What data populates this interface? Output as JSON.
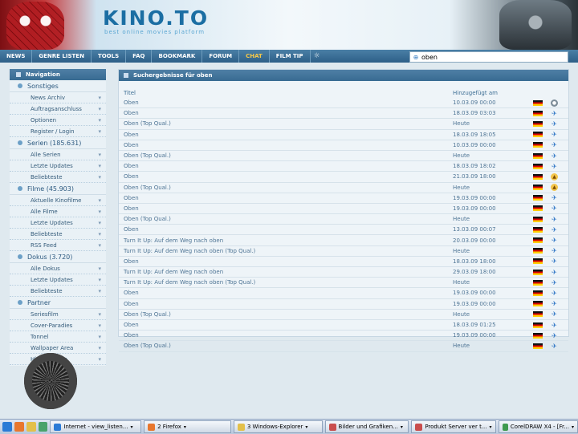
{
  "brand": {
    "logo": "KINO.TO",
    "tagline": "best online movies platform"
  },
  "nav": {
    "items": [
      "NEWS",
      "GENRE LISTEN",
      "TOOLS",
      "FAQ",
      "BOOKMARK",
      "FORUM",
      "CHAT",
      "FILM TIP"
    ],
    "active": "CHAT"
  },
  "search": {
    "value": "oben"
  },
  "sidebar": {
    "header": "Navigation",
    "sections": [
      {
        "title": "Sonstiges",
        "items": [
          "News Archiv",
          "Auftragsanschluss",
          "Optionen",
          "Register / Login"
        ]
      },
      {
        "title": "Serien (185.631)",
        "items": [
          "Alle Serien",
          "Letzte Updates",
          "Beliebteste"
        ]
      },
      {
        "title": "Filme (45.903)",
        "items": [
          "Aktuelle Kinofilme",
          "Alle Filme",
          "Letzte Updates",
          "Beliebteste",
          "RSS Feed"
        ]
      },
      {
        "title": "Dokus (3.720)",
        "items": [
          "Alle Dokus",
          "Letzte Updates",
          "Beliebteste"
        ]
      },
      {
        "title": "Partner",
        "items": [
          "Seriesfilm",
          "Cover-Paradies",
          "Tonnel",
          "Wallpaper Area",
          "Hir-Phys.com"
        ]
      }
    ]
  },
  "results": {
    "header": "Suchergebnisse für oben",
    "col_title": "Titel",
    "col_date": "Hinzugefügt am",
    "rows": [
      {
        "title": "Oben",
        "date": "10.03.09 00:00",
        "hoster": "grey"
      },
      {
        "title": "Oben",
        "date": "18.03.09 03:03",
        "hoster": "blue"
      },
      {
        "title": "Oben (Top Qual.)",
        "date": "Heute",
        "hoster": "blue"
      },
      {
        "title": "Oben",
        "date": "18.03.09 18:05",
        "hoster": "blue"
      },
      {
        "title": "Oben",
        "date": "10.03.09 00:00",
        "hoster": "blue"
      },
      {
        "title": "Oben (Top Qual.)",
        "date": "Heute",
        "hoster": "blue"
      },
      {
        "title": "Oben",
        "date": "18.03.09 18:02",
        "hoster": "blue"
      },
      {
        "title": "Oben",
        "date": "21.03.09 18:00",
        "hoster": "yellow"
      },
      {
        "title": "Oben (Top Qual.)",
        "date": "Heute",
        "hoster": "yellow"
      },
      {
        "title": "Oben",
        "date": "19.03.09 00:00",
        "hoster": "blue"
      },
      {
        "title": "Oben",
        "date": "19.03.09 00:00",
        "hoster": "blue"
      },
      {
        "title": "Oben (Top Qual.)",
        "date": "Heute",
        "hoster": "blue"
      },
      {
        "title": "Oben",
        "date": "13.03.09 00:07",
        "hoster": "blue"
      },
      {
        "title": "Turn It Up: Auf dem Weg nach oben",
        "date": "20.03.09 00:00",
        "hoster": "blue"
      },
      {
        "title": "Turn It Up: Auf dem Weg nach oben (Top Qual.)",
        "date": "Heute",
        "hoster": "blue"
      },
      {
        "title": "Oben",
        "date": "18.03.09 18:00",
        "hoster": "blue"
      },
      {
        "title": "Turn It Up: Auf dem Weg nach oben",
        "date": "29.03.09 18:00",
        "hoster": "blue"
      },
      {
        "title": "Turn It Up: Auf dem Weg nach oben (Top Qual.)",
        "date": "Heute",
        "hoster": "blue"
      },
      {
        "title": "Oben",
        "date": "19.03.09 00:00",
        "hoster": "blue"
      },
      {
        "title": "Oben",
        "date": "19.03.09 00:00",
        "hoster": "blue"
      },
      {
        "title": "Oben (Top Qual.)",
        "date": "Heute",
        "hoster": "blue"
      },
      {
        "title": "Oben",
        "date": "18.03.09 01:25",
        "hoster": "blue"
      },
      {
        "title": "Oben",
        "date": "19.03.09 00:00",
        "hoster": "blue"
      },
      {
        "title": "Oben (Top Qual.)",
        "date": "Heute",
        "hoster": "blue"
      }
    ]
  },
  "taskbar": {
    "tasks": [
      {
        "label": "Internet - view_listen...",
        "width": 105
      },
      {
        "label": "2 Firefox",
        "width": 100
      },
      {
        "label": "3 Windows-Explorer",
        "width": 102
      },
      {
        "label": "Bilder und Grafiken...",
        "width": 96
      },
      {
        "label": "Produkt Server ver t...",
        "width": 97
      },
      {
        "label": "CorelDRAW X4 - [Fr...",
        "width": 90
      }
    ]
  },
  "colors": {
    "accent": "#386b92",
    "link": "#2a72c4",
    "highlight": "#f7c948"
  }
}
